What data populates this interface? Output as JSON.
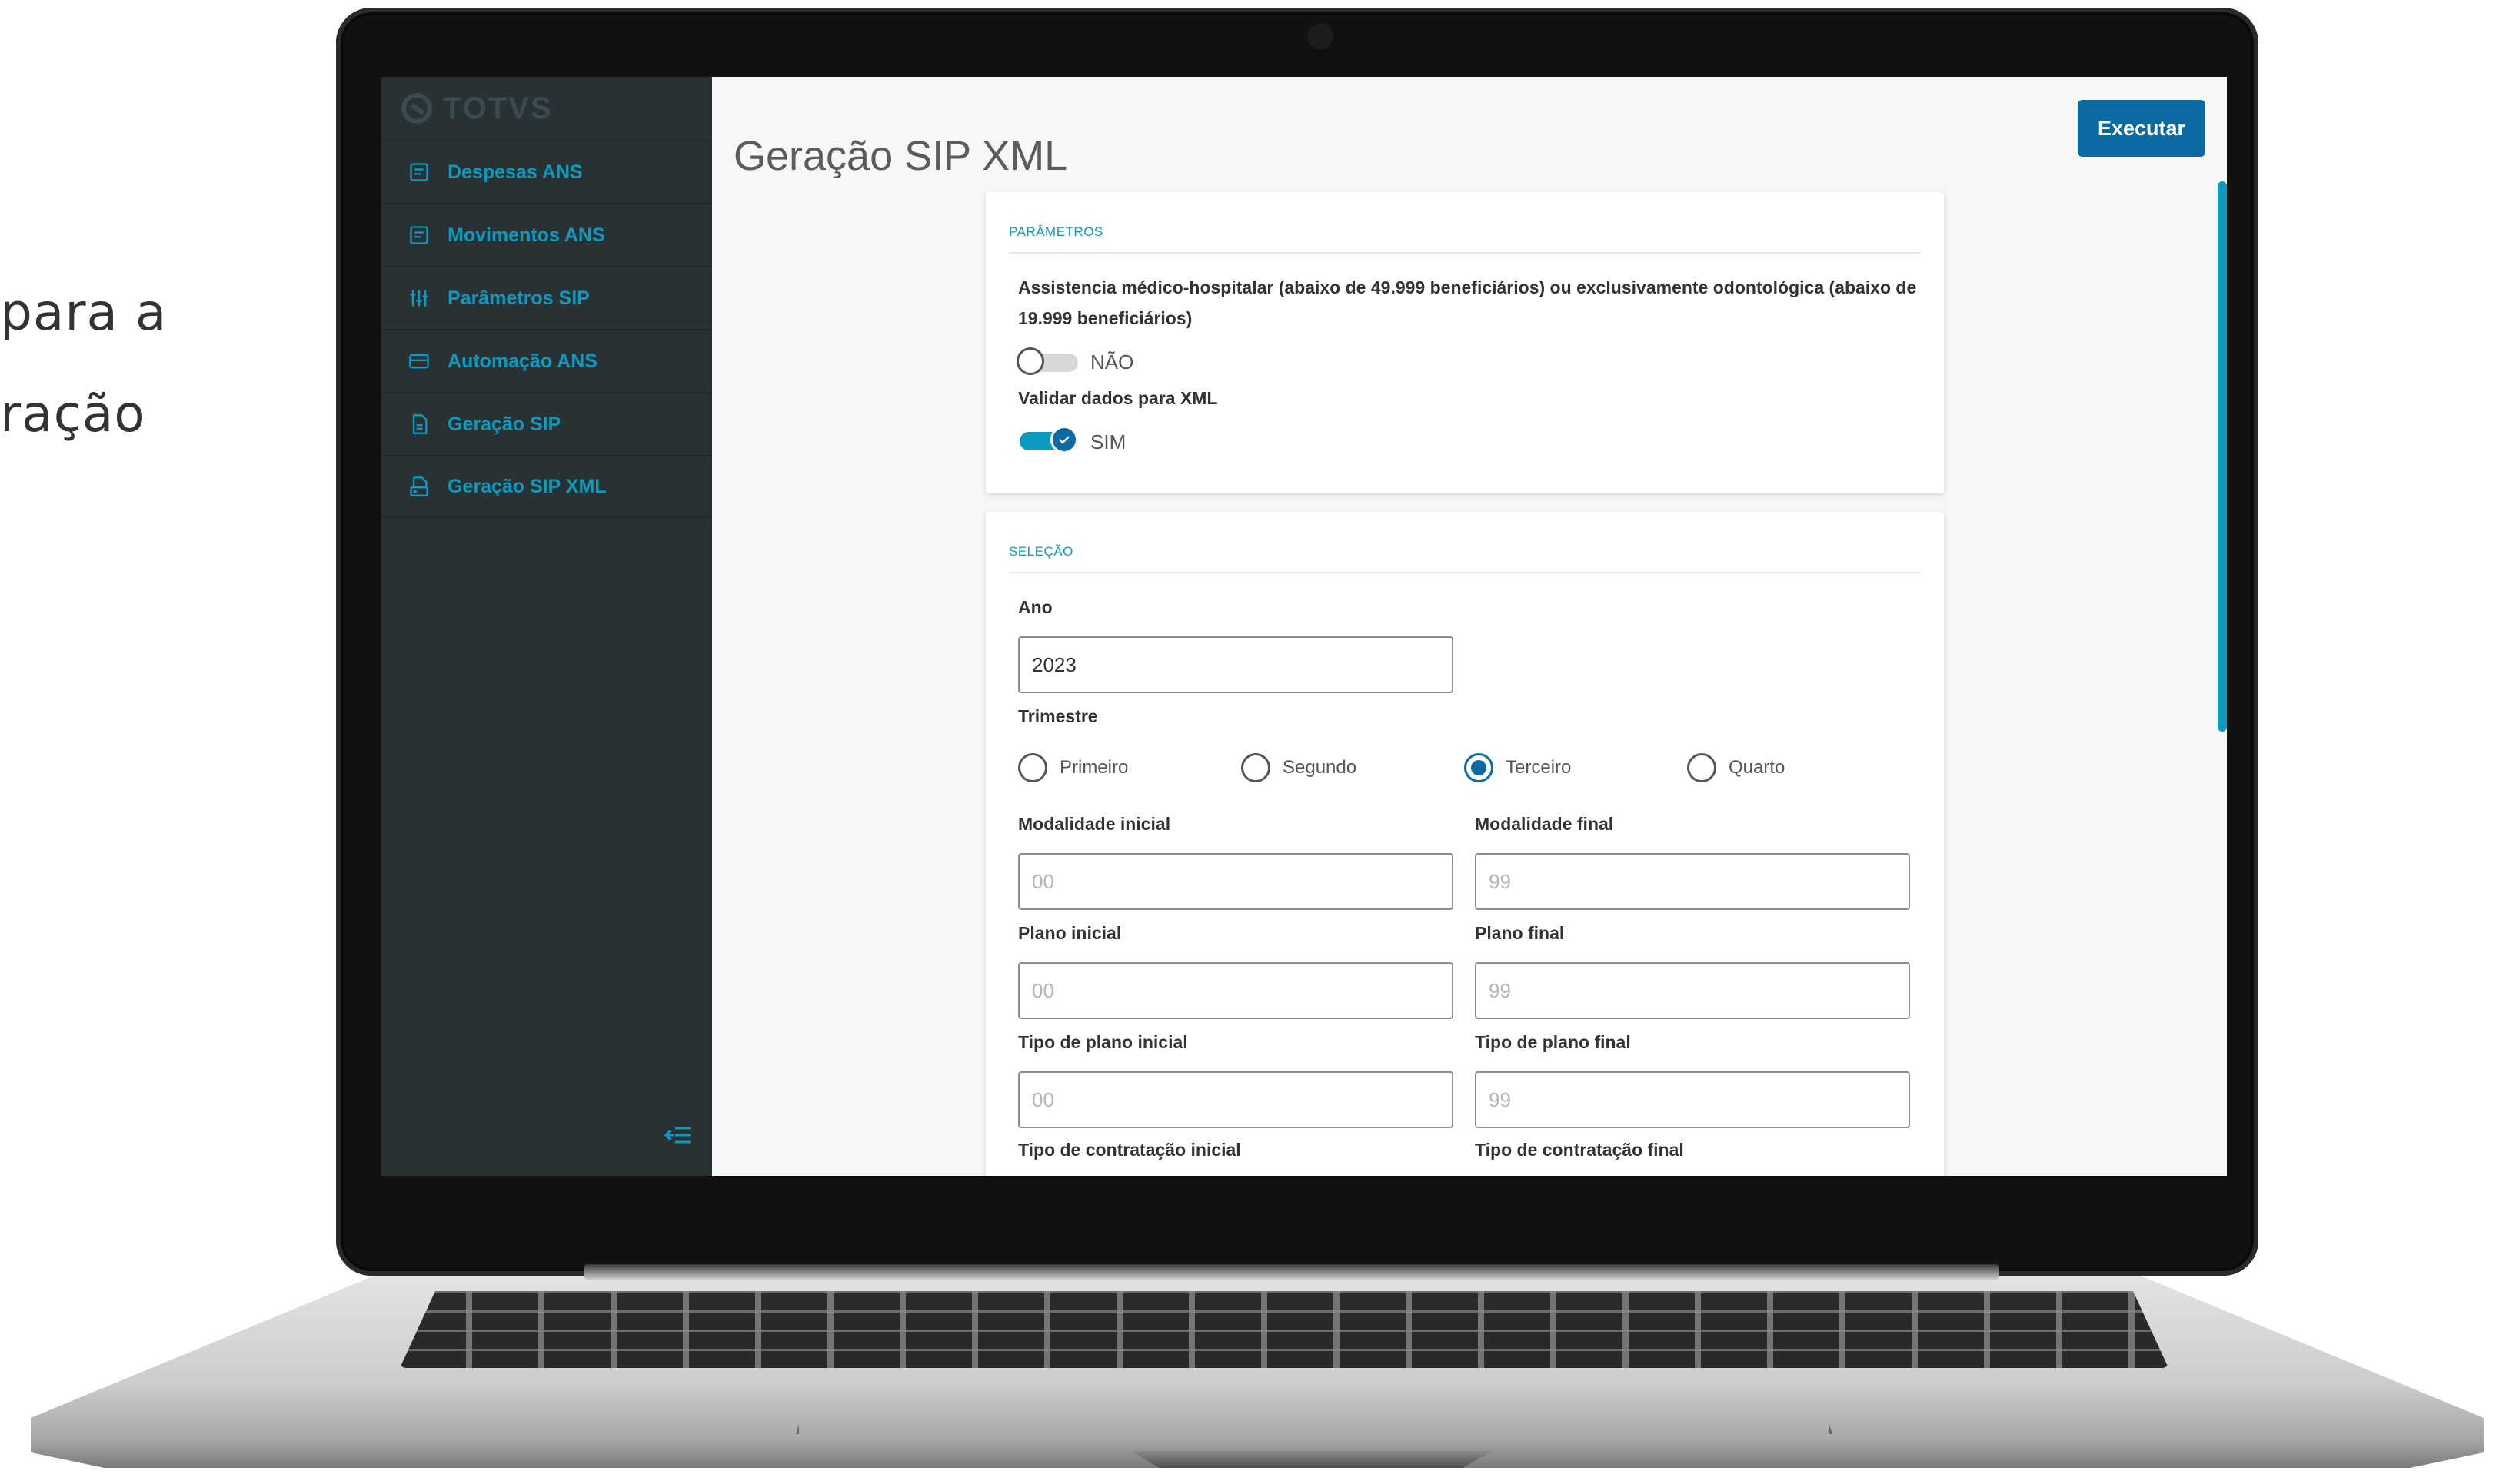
{
  "background_text": {
    "line1": "para a",
    "line2": "ração"
  },
  "brand": {
    "logo": "TOTVS"
  },
  "sidebar": {
    "items": [
      {
        "label": "Despesas ANS",
        "icon": "document-list-icon"
      },
      {
        "label": "Movimentos ANS",
        "icon": "document-list-icon"
      },
      {
        "label": "Parâmetros SIP",
        "icon": "sliders-icon"
      },
      {
        "label": "Automação ANS",
        "icon": "card-icon"
      },
      {
        "label": "Geração SIP",
        "icon": "file-icon"
      },
      {
        "label": "Geração SIP XML",
        "icon": "xml-file-icon"
      }
    ],
    "collapse_icon": "collapse-menu-icon"
  },
  "header": {
    "title": "Geração SIP XML",
    "execute_label": "Executar"
  },
  "parametros": {
    "title": "PARÂMETROS",
    "assist_label": "Assistencia médico-hospitalar (abaixo de 49.999 beneficiários) ou exclusivamente odontológica (abaixo de 19.999 beneficiários)",
    "assist_value": "NÃO",
    "assist_on": false,
    "validar_label": "Validar dados para XML",
    "validar_value": "SIM",
    "validar_on": true
  },
  "selecao": {
    "title": "SELEÇÃO",
    "ano_label": "Ano",
    "ano_value": "2023",
    "trimestre_label": "Trimestre",
    "trimestre_options": [
      "Primeiro",
      "Segundo",
      "Terceiro",
      "Quarto"
    ],
    "trimestre_selected": "Terceiro",
    "mod_ini_label": "Modalidade inicial",
    "mod_ini_placeholder": "00",
    "mod_fin_label": "Modalidade final",
    "mod_fin_placeholder": "99",
    "plano_ini_label": "Plano inicial",
    "plano_ini_placeholder": "00",
    "plano_fin_label": "Plano final",
    "plano_fin_placeholder": "99",
    "tipo_plano_ini_label": "Tipo de plano inicial",
    "tipo_plano_ini_placeholder": "00",
    "tipo_plano_fin_label": "Tipo de plano final",
    "tipo_plano_fin_placeholder": "99",
    "tipo_contr_ini_label": "Tipo de contratação inicial",
    "tipo_contr_fin_label": "Tipo de contratação final"
  },
  "colors": {
    "accent": "#0c9abe",
    "primary": "#0b6aa2",
    "sidebar_bg": "#283234"
  }
}
